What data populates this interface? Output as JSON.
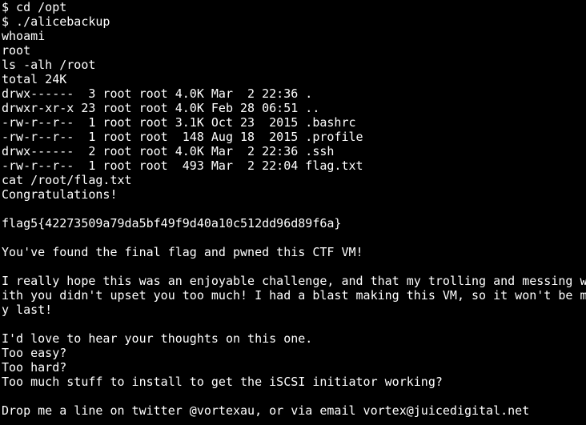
{
  "terminal": {
    "background": "#000000",
    "foreground": "#ffffff",
    "lines": [
      "$ cd /opt",
      "$ ./alicebackup",
      "whoami",
      "root",
      "ls -alh /root",
      "total 24K",
      "drwx------  3 root root 4.0K Mar  2 22:36 .",
      "drwxr-xr-x 23 root root 4.0K Feb 28 06:51 ..",
      "-rw-r--r--  1 root root 3.1K Oct 23  2015 .bashrc",
      "-rw-r--r--  1 root root  148 Aug 18  2015 .profile",
      "drwx------  2 root root 4.0K Mar  2 22:36 .ssh",
      "-rw-r--r--  1 root root  493 Mar  2 22:04 flag.txt",
      "cat /root/flag.txt",
      "Congratulations!",
      "",
      "flag5{42273509a79da5bf49f9d40a10c512dd96d89f6a}",
      "",
      "You've found the final flag and pwned this CTF VM!",
      "",
      "I really hope this was an enjoyable challenge, and that my trolling and messing w",
      "ith you didn't upset you too much! I had a blast making this VM, so it won't be m",
      "y last!",
      "",
      "I'd love to hear your thoughts on this one.",
      "Too easy?",
      "Too hard?",
      "Too much stuff to install to get the iSCSI initiator working?",
      "",
      "Drop me a line on twitter @vortexau, or via email vortex@juicedigital.net"
    ]
  }
}
